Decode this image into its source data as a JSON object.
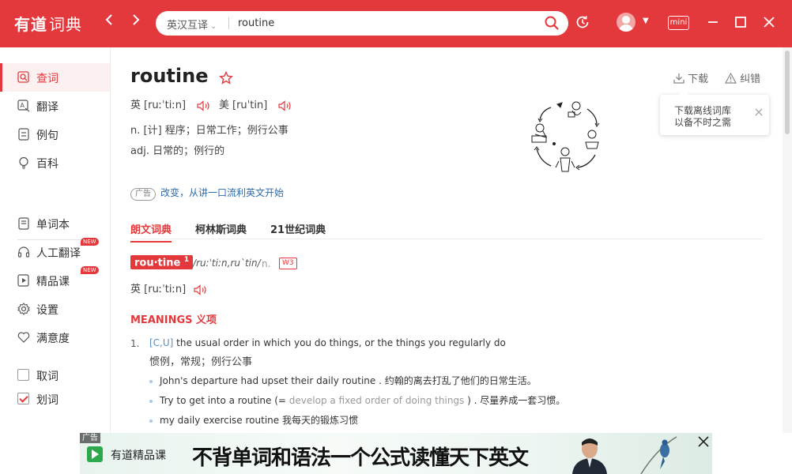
{
  "app": {
    "logo_brand": "有道",
    "logo_product": "词典"
  },
  "search": {
    "lang": "英汉互译",
    "query": "routine"
  },
  "window": {
    "mini_label": "mini"
  },
  "sidebar": {
    "nav": [
      {
        "label": "查词",
        "icon": "search-doc-icon",
        "active": true
      },
      {
        "label": "翻译",
        "icon": "translate-icon"
      },
      {
        "label": "例句",
        "icon": "sentence-icon"
      },
      {
        "label": "百科",
        "icon": "bulb-icon"
      }
    ],
    "tools": [
      {
        "label": "单词本",
        "icon": "notebook-icon"
      },
      {
        "label": "人工翻译",
        "icon": "headset-icon",
        "badge": "NEW"
      },
      {
        "label": "精品课",
        "icon": "play-icon",
        "badge": "NEW"
      },
      {
        "label": "设置",
        "icon": "gear-icon"
      },
      {
        "label": "满意度",
        "icon": "heart-icon"
      }
    ],
    "toggles": [
      {
        "label": "取词",
        "checked": false
      },
      {
        "label": "划词",
        "checked": true
      }
    ]
  },
  "entry": {
    "word": "routine",
    "uk_label": "英",
    "uk_ipa": "[ruːˈtiːn]",
    "us_label": "美",
    "us_ipa": "[ruˈtin]",
    "defs": [
      "n. [计] 程序；日常工作；例行公事",
      "adj. 日常的；例行的"
    ],
    "ad_tag": "广告",
    "ad_text": "改变，从讲一口流利英文开始",
    "download_label": "下载",
    "feedback_label": "纠错",
    "popover_line1": "下载离线词库",
    "popover_line2": "以备不时之需"
  },
  "tabs": [
    "朗文词典",
    "柯林斯词典",
    "21世纪词典"
  ],
  "longman": {
    "headword": "rou·tine",
    "sense_no": "1",
    "ipa": "/ruːˈtiːn,ruˋtin/",
    "pos": "n.",
    "freq": "W3",
    "uk_label": "英",
    "uk_ipa": "[ruːˈtiːn]",
    "meanings_heading": "MEANINGS 义项",
    "def_number": "1.",
    "grammar": "[C,U]",
    "def_en": " the usual order in which you do things, or the things you regularly do",
    "def_cn": "惯例，常规；例行公事",
    "ex1_en": "John's departure had upset their daily routine .",
    "ex1_cn": "约翰的离去打乱了他们的日常生活。",
    "ex2_pre": "Try to get into a routine (= ",
    "ex2_gloss": "develop a fixed order of doing things",
    "ex2_post": " ) . 尽量养成一套习惯。",
    "ex3": "my daily exercise routine 我每天的锻炼习惯"
  },
  "bottom_ad": {
    "tag": "广告",
    "brand": "有道精品课",
    "slogan": "不背单词和语法一个公式读懂天下英文"
  }
}
